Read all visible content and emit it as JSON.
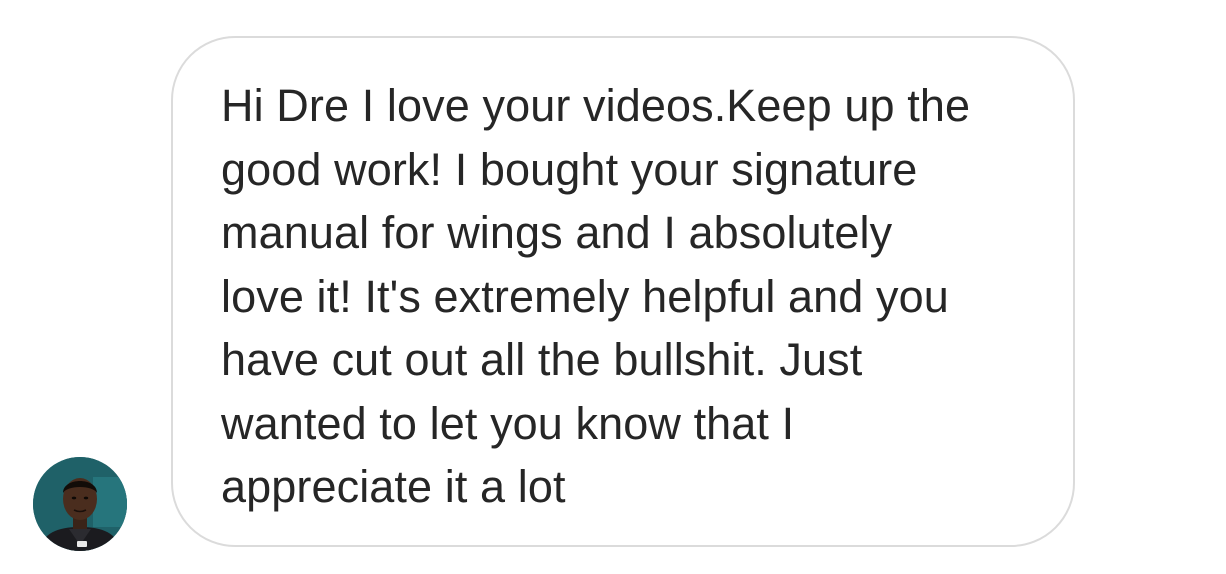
{
  "message": {
    "text": "Hi Dre I love your videos.Keep up the\ngood work! I bought your signature\nmanual for wings and I absolutely\nlove it! It's extremely helpful and you\nhave cut out all the bullshit. Just\nwanted to let you know that I\nappreciate it a lot"
  },
  "sender": {
    "avatar_icon": "profile-photo-icon"
  },
  "colors": {
    "bubble_border": "#dbdbdb",
    "text": "#262626",
    "background": "#ffffff"
  }
}
